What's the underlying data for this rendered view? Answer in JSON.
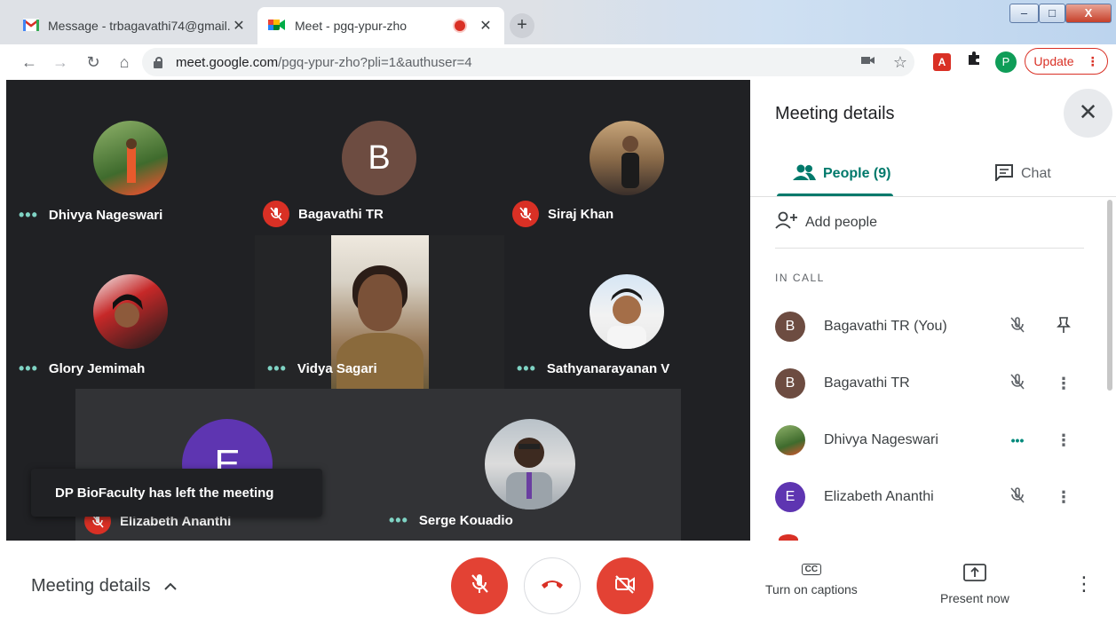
{
  "browser": {
    "tabs": [
      {
        "icon": "gmail-icon",
        "title": "Message - trbagavathi74@gmail.",
        "close": "✕"
      },
      {
        "icon": "meet-icon",
        "title": "Meet - pgq-ypur-zho",
        "close": "✕"
      }
    ],
    "new_tab": "+",
    "window_controls": {
      "minimize": "–",
      "maximize": "□",
      "close": "X"
    },
    "url_host": "meet.google.com",
    "url_path": "/pgq-ypur-zho?pli=1&authuser=4",
    "profile_initial": "P",
    "update_label": "Update",
    "pdf_label": "A"
  },
  "participants": [
    {
      "name": "Dhivya Nageswari",
      "status": "speaking-dots",
      "avatar": "photo"
    },
    {
      "name": "Bagavathi TR",
      "status": "muted",
      "avatar": "initial",
      "initial": "B",
      "color": "#6d4c41"
    },
    {
      "name": "Siraj Khan",
      "status": "muted",
      "avatar": "photo"
    },
    {
      "name": "Glory Jemimah",
      "status": "speaking-dots",
      "avatar": "photo"
    },
    {
      "name": "Vidya Sagari",
      "status": "speaking-dots",
      "avatar": "video"
    },
    {
      "name": "Sathyanarayanan V",
      "status": "speaking-dots",
      "avatar": "photo"
    },
    {
      "name": "Elizabeth Ananthi",
      "status": "muted",
      "avatar": "initial",
      "initial": "E",
      "color": "#5e35b1"
    },
    {
      "name": "Serge Kouadio",
      "status": "speaking-dots",
      "avatar": "photo"
    }
  ],
  "dots": "•••",
  "toast": "DP BioFaculty has left the meeting",
  "panel": {
    "title": "Meeting details",
    "close": "✕",
    "tab_people": "People (9)",
    "tab_chat": "Chat",
    "add_people": "Add people",
    "in_call": "IN CALL",
    "rows": [
      {
        "initial": "B",
        "name": "Bagavathi TR (You)",
        "color": "#6d4c41",
        "action": "pin"
      },
      {
        "initial": "B",
        "name": "Bagavathi TR",
        "color": "#6d4c41",
        "action": "more"
      },
      {
        "initial": "",
        "name": "Dhivya Nageswari",
        "color": "#5b7a3a",
        "action": "more"
      },
      {
        "initial": "E",
        "name": "Elizabeth Ananthi",
        "color": "#5e35b1",
        "action": "more"
      }
    ],
    "more_glyph": "⋮"
  },
  "bottom": {
    "meeting_details": "Meeting details",
    "chevron": "^",
    "captions_label": "Turn on captions",
    "captions_icon": "CC",
    "present_label": "Present now",
    "more_glyph": "⋮"
  },
  "colors": {
    "accent": "#00796b",
    "danger": "#e34234",
    "stage": "#202124"
  }
}
